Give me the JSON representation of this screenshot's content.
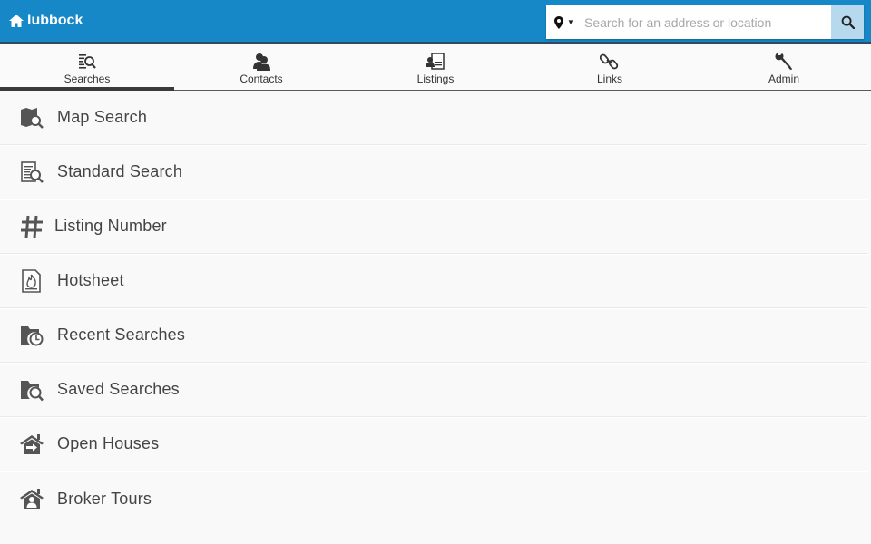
{
  "header": {
    "brand": "lubbock",
    "brand_icon": "home-icon",
    "search": {
      "placeholder": "Search for an address or location",
      "value": "",
      "location_icon": "map-marker-icon",
      "button_icon": "search-icon"
    },
    "colors": {
      "bar": "#1688c8",
      "search_button": "#b6d9ee"
    }
  },
  "tabs": [
    {
      "label": "Searches",
      "icon": "searches-icon",
      "active": true
    },
    {
      "label": "Contacts",
      "icon": "contacts-icon",
      "active": false
    },
    {
      "label": "Listings",
      "icon": "listings-icon",
      "active": false
    },
    {
      "label": "Links",
      "icon": "links-icon",
      "active": false
    },
    {
      "label": "Admin",
      "icon": "wrench-icon",
      "active": false
    }
  ],
  "menu": [
    {
      "label": "Map Search",
      "icon": "map-search-icon"
    },
    {
      "label": "Standard Search",
      "icon": "standard-search-icon"
    },
    {
      "label": "Listing Number",
      "icon": "hash-icon"
    },
    {
      "label": "Hotsheet",
      "icon": "hotsheet-icon"
    },
    {
      "label": "Recent Searches",
      "icon": "recent-searches-icon"
    },
    {
      "label": "Saved Searches",
      "icon": "saved-searches-icon"
    },
    {
      "label": "Open Houses",
      "icon": "open-house-icon"
    },
    {
      "label": "Broker Tours",
      "icon": "broker-tour-icon"
    }
  ]
}
